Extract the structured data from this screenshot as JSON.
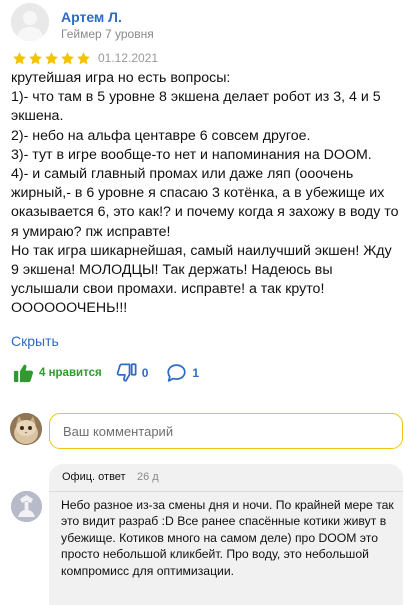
{
  "review": {
    "author_name": "Артем Л.",
    "author_level": "Геймер 7 уровня",
    "rating": 5,
    "date": "01.12.2021",
    "lines": [
      "крутейшая игра но есть вопросы:",
      "1)- что там в 5 уровне 8 экшена делает робот из 3, 4 и 5 экшена.",
      "2)- небо на альфа центавре 6 совсем другое.",
      "3)- тут в игре вообще-то нет и напоминания на DOOM.",
      "4)- и самый главный промах или даже ляп (ооочень жирный,- в 6 уровне я спасаю 3 котёнка, а в убежище их оказывается 6, это как!? и почему когда я захожу в воду то я умираю? пж исправте!",
      "Но так игра шикарнейшая, самый наилучший экшен! Жду 9 экшена! МОЛОДЦЫ! Так держать! Надеюсь вы услышали свои промахи. исправте! а так круто! ООООООЧЕНЬ!!!"
    ],
    "collapse_label": "Скрыть"
  },
  "actions": {
    "likes_label": "4 нравится",
    "dislikes_count": "0",
    "comments_count": "1"
  },
  "comment_box": {
    "placeholder": "Ваш комментарий"
  },
  "official_reply": {
    "label": "Офиц. ответ",
    "age": "26 д",
    "text": "Небо разное из-за смены дня и ночи. По крайней мере так это видит разраб :D  Все ранее спасённые котики живут в убежище. Котиков много на самом деле)  про DOOM это просто небольшой кликбейт. Про воду, это небольшой компромисс для оптимизации."
  },
  "colors": {
    "link_blue": "#2d6bc5",
    "star_gold": "#f5c400",
    "like_green": "#2f9b2f",
    "input_border": "#f2c318"
  },
  "icons": {
    "author_avatar": "user-silhouette-icon",
    "like": "thumbs-up-icon",
    "dislike": "thumbs-down-icon",
    "comments": "comment-bubble-icon"
  }
}
